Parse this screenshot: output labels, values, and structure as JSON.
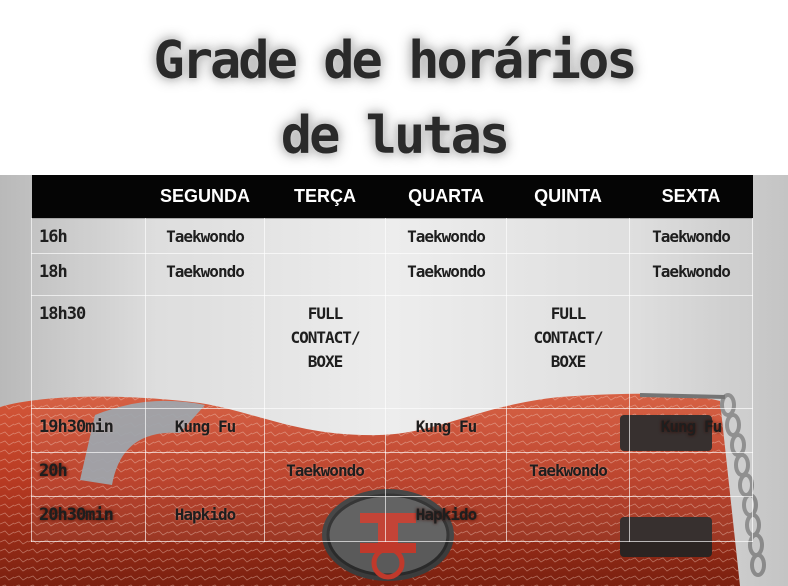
{
  "title": {
    "line1": "Grade de horários",
    "line2": "de lutas"
  },
  "schedule": {
    "days": [
      "SEGUNDA",
      "TERÇA",
      "QUARTA",
      "QUINTA",
      "SEXTA"
    ],
    "rows": [
      {
        "time": "16h",
        "cells": [
          "Taekwondo",
          "",
          "Taekwondo",
          "",
          "Taekwondo"
        ]
      },
      {
        "time": "18h",
        "cells": [
          "Taekwondo",
          "",
          "Taekwondo",
          "",
          "Taekwondo"
        ]
      },
      {
        "time": "18h30",
        "cells": [
          "",
          "FULL CONTACT/ BOXE",
          "",
          "FULL CONTACT/ BOXE",
          ""
        ]
      },
      {
        "time": "19h30min",
        "cells": [
          "Kung Fu",
          "",
          "Kung Fu",
          "",
          "Kung Fu"
        ]
      },
      {
        "time": "20h",
        "cells": [
          "",
          "Taekwondo",
          "",
          "Taekwondo",
          ""
        ]
      },
      {
        "time": "20h30min",
        "cells": [
          "Hapkido",
          "",
          "Hapkido",
          "",
          ""
        ]
      }
    ]
  },
  "colors": {
    "header_bg": "#050505",
    "header_text": "#ffffff",
    "bag_red": "#b83a22",
    "bag_dark": "#6e1a0c"
  },
  "icons": [
    "punching-bag-illustration",
    "chain-icon",
    "logo-emblem-icon"
  ]
}
